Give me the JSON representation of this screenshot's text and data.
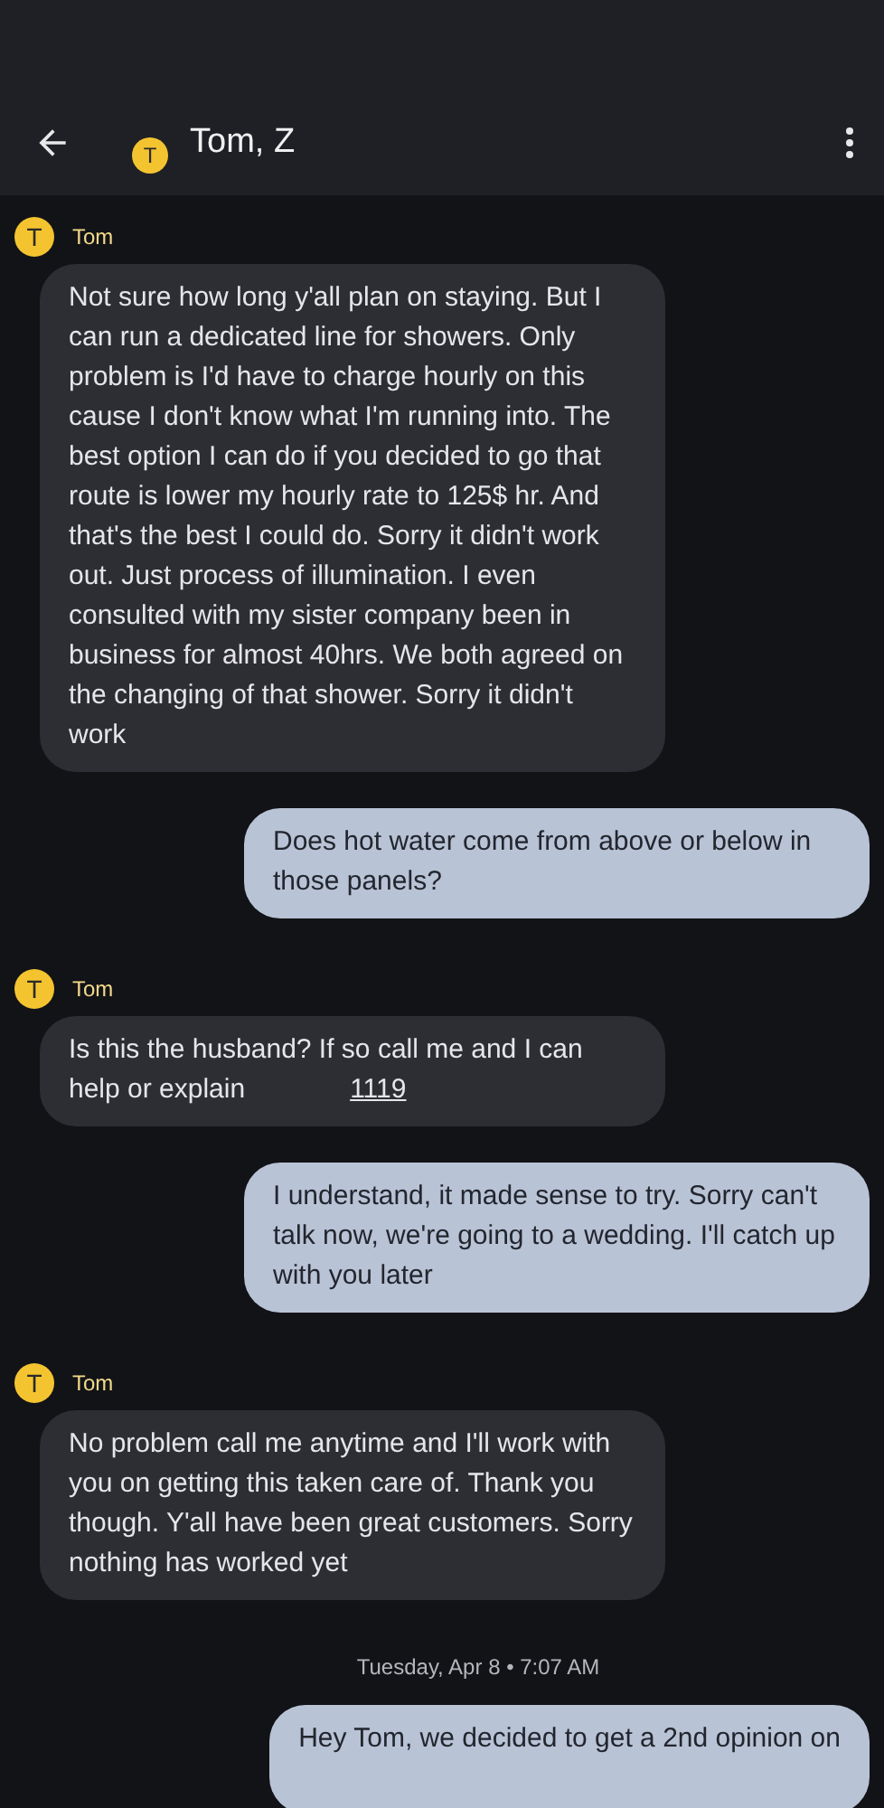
{
  "header": {
    "title": "Tom, Z",
    "avatar_initial": "T"
  },
  "messages": [
    {
      "kind": "incoming",
      "sender": "Tom",
      "initial": "T",
      "text": "Not sure how long y'all plan on staying. But I can run a dedicated line for showers. Only problem is I'd have to charge hourly on this cause I don't know what I'm running into. The best option I can do if you decided to go that route is lower my hourly rate to 125$ hr. And that's the best I could do. Sorry it didn't work out. Just process of illumination.  I even consulted with my sister company been in business for almost 40hrs. We both agreed on the changing of that shower. Sorry it didn't work"
    },
    {
      "kind": "outgoing",
      "text": "Does hot water come from above or below in those panels?"
    },
    {
      "kind": "incoming",
      "sender": "Tom",
      "initial": "T",
      "text": "Is this the husband? If so call me and I can help or explain",
      "link": "1119"
    },
    {
      "kind": "outgoing",
      "text": "I understand, it made sense to try.  Sorry can't talk now, we're going to a wedding.  I'll catch up with you later"
    },
    {
      "kind": "incoming",
      "sender": "Tom",
      "initial": "T",
      "text": "No problem call me anytime and I'll work with you on getting this taken care of. Thank you though. Y'all have been great customers. Sorry nothing has worked yet"
    },
    {
      "kind": "timestamp",
      "text": "Tuesday, Apr 8 • 7:07 AM"
    },
    {
      "kind": "outgoing",
      "text": "Hey Tom, we decided to get a 2nd opinion on"
    }
  ]
}
